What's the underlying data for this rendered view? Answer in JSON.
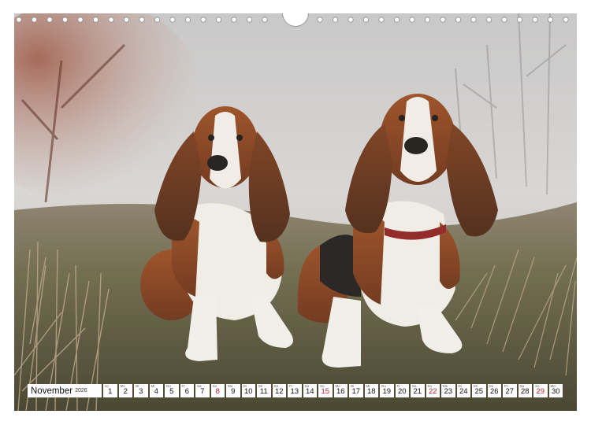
{
  "calendar": {
    "month": "November",
    "year": "2026",
    "days": [
      {
        "num": "1",
        "abbr": "so",
        "highlight": false
      },
      {
        "num": "2",
        "abbr": "Mo",
        "highlight": false
      },
      {
        "num": "3",
        "abbr": "Di",
        "highlight": false
      },
      {
        "num": "4",
        "abbr": "Mi",
        "highlight": false
      },
      {
        "num": "5",
        "abbr": "Do",
        "highlight": false
      },
      {
        "num": "6",
        "abbr": "Fr",
        "highlight": false
      },
      {
        "num": "7",
        "abbr": "Sa",
        "highlight": false
      },
      {
        "num": "8",
        "abbr": "So",
        "highlight": true
      },
      {
        "num": "9",
        "abbr": "Mo",
        "highlight": false
      },
      {
        "num": "10",
        "abbr": "Di",
        "highlight": false
      },
      {
        "num": "11",
        "abbr": "Mi",
        "highlight": false
      },
      {
        "num": "12",
        "abbr": "Do",
        "highlight": false
      },
      {
        "num": "13",
        "abbr": "Fr",
        "highlight": false
      },
      {
        "num": "14",
        "abbr": "Sa",
        "highlight": false
      },
      {
        "num": "15",
        "abbr": "So",
        "highlight": true
      },
      {
        "num": "16",
        "abbr": "Mo",
        "highlight": false
      },
      {
        "num": "17",
        "abbr": "Di",
        "highlight": false
      },
      {
        "num": "18",
        "abbr": "Mi",
        "highlight": false
      },
      {
        "num": "19",
        "abbr": "Do",
        "highlight": false
      },
      {
        "num": "20",
        "abbr": "Fr",
        "highlight": false
      },
      {
        "num": "21",
        "abbr": "Sa",
        "highlight": false
      },
      {
        "num": "22",
        "abbr": "So",
        "highlight": true
      },
      {
        "num": "23",
        "abbr": "Mo",
        "highlight": false
      },
      {
        "num": "24",
        "abbr": "Di",
        "highlight": false
      },
      {
        "num": "25",
        "abbr": "Mi",
        "highlight": false
      },
      {
        "num": "26",
        "abbr": "Do",
        "highlight": false
      },
      {
        "num": "27",
        "abbr": "Fr",
        "highlight": false
      },
      {
        "num": "28",
        "abbr": "Sa",
        "highlight": false
      },
      {
        "num": "29",
        "abbr": "So",
        "highlight": true
      },
      {
        "num": "30",
        "abbr": "Mo",
        "highlight": false
      }
    ]
  },
  "colors": {
    "sunday_highlight": "#b3262b",
    "grass": "#5d5a3a",
    "fog": "#d6d4d2"
  },
  "binding": {
    "left_holes": 17,
    "right_holes": 17
  }
}
